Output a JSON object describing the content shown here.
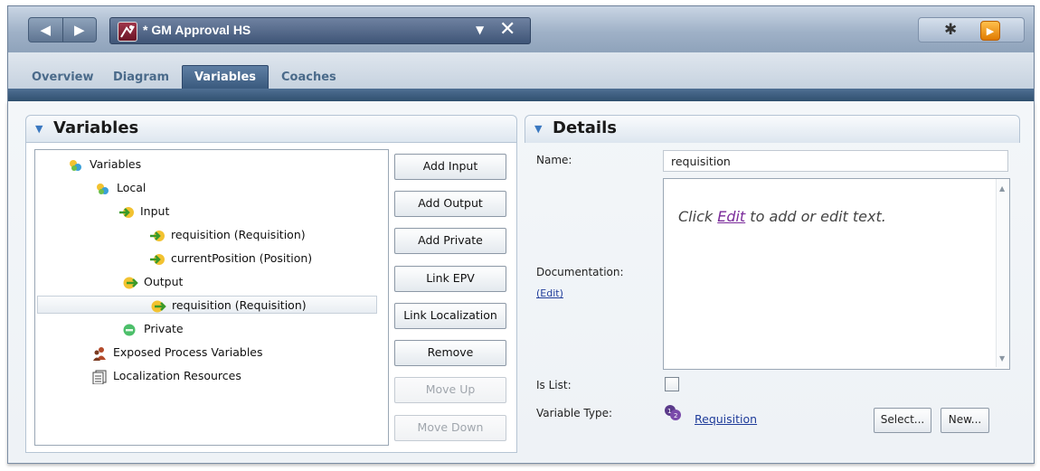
{
  "window": {
    "title": "* GM Approval HS",
    "dropdown_glyph": "▼",
    "close_glyph": "✕",
    "nav_back_glyph": "◀",
    "nav_forward_glyph": "▶",
    "bug_glyph": "✱",
    "run_glyph": "▶"
  },
  "tabs": [
    {
      "label": "Overview"
    },
    {
      "label": "Diagram"
    },
    {
      "label": "Variables"
    },
    {
      "label": "Coaches"
    }
  ],
  "variables_section": {
    "title": "Variables",
    "tree": [
      {
        "label": "Variables",
        "icon": "variables-group-icon"
      },
      {
        "label": "Local",
        "icon": "variables-group-icon"
      },
      {
        "label": "Input",
        "icon": "input-arrow-icon"
      },
      {
        "label": "requisition (Requisition)",
        "icon": "input-arrow-icon"
      },
      {
        "label": "currentPosition (Position)",
        "icon": "input-arrow-icon"
      },
      {
        "label": "Output",
        "icon": "output-arrow-icon"
      },
      {
        "label": "requisition (Requisition)",
        "icon": "output-arrow-icon",
        "selected": true
      },
      {
        "label": "Private",
        "icon": "private-circle-icon"
      },
      {
        "label": "Exposed Process Variables",
        "icon": "people-icon"
      },
      {
        "label": "Localization Resources",
        "icon": "resources-icon"
      }
    ],
    "buttons": {
      "add_input": "Add Input",
      "add_output": "Add Output",
      "add_private": "Add Private",
      "link_epv": "Link EPV",
      "link_localization": "Link Localization",
      "remove": "Remove",
      "move_up": "Move Up",
      "move_down": "Move Down"
    }
  },
  "details_section": {
    "title": "Details",
    "name_label": "Name:",
    "name_value": "requisition",
    "documentation_label": "Documentation:",
    "documentation_edit": "(Edit)",
    "doc_prompt_before": "Click ",
    "doc_prompt_link": "Edit",
    "doc_prompt_after": " to add or edit text.",
    "is_list_label": "Is List:",
    "is_list_checked": false,
    "variable_type_label": "Variable Type:",
    "variable_type_value": "Requisition",
    "select_button": "Select...",
    "new_button": "New..."
  }
}
